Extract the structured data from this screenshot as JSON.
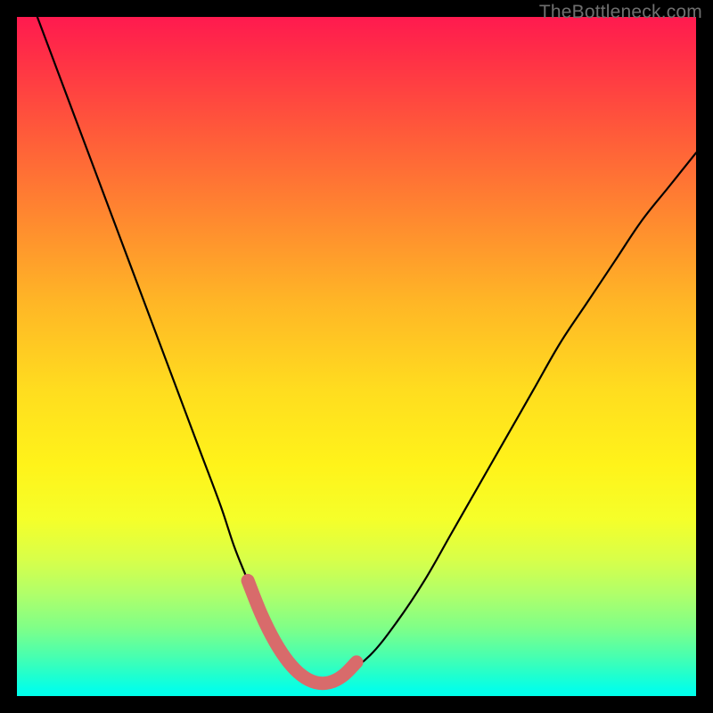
{
  "watermark": "TheBottleneck.com",
  "chart_data": {
    "type": "line",
    "title": "",
    "xlabel": "",
    "ylabel": "",
    "xlim": [
      0,
      100
    ],
    "ylim": [
      0,
      100
    ],
    "series": [
      {
        "name": "bottleneck-curve",
        "x": [
          3,
          6,
          9,
          12,
          15,
          18,
          21,
          24,
          27,
          30,
          32,
          34,
          36,
          38,
          40,
          42,
          44,
          46,
          48,
          52,
          56,
          60,
          64,
          68,
          72,
          76,
          80,
          84,
          88,
          92,
          96,
          100
        ],
        "y": [
          100,
          92,
          84,
          76,
          68,
          60,
          52,
          44,
          36,
          28,
          22,
          17,
          12,
          8,
          5,
          3,
          2,
          2,
          3,
          6,
          11,
          17,
          24,
          31,
          38,
          45,
          52,
          58,
          64,
          70,
          75,
          80
        ]
      },
      {
        "name": "highlight-segment",
        "x": [
          34,
          36,
          38,
          40,
          42,
          44,
          46,
          48,
          50
        ],
        "y": [
          17,
          12,
          8,
          5,
          3,
          2,
          2,
          3,
          5
        ]
      }
    ],
    "colors": {
      "curve": "#000000",
      "highlight": "#d86b6b"
    }
  }
}
